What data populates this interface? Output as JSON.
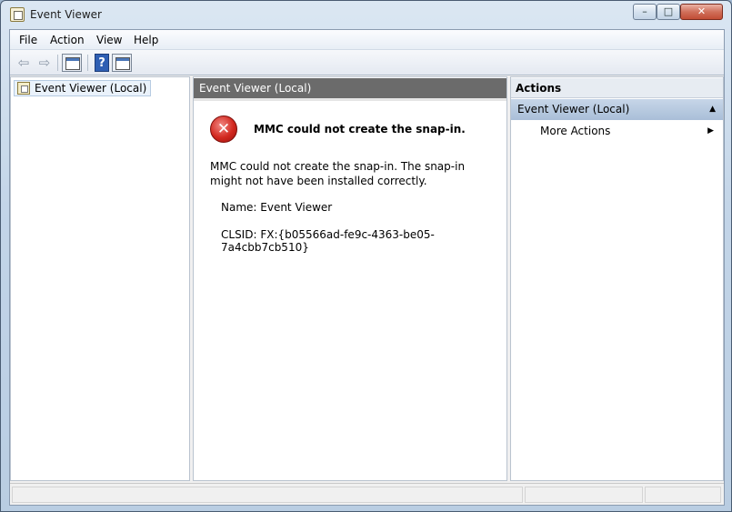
{
  "window": {
    "title": "Event Viewer",
    "minimize": "–",
    "maximize": "□",
    "close": "✕"
  },
  "menu": [
    "File",
    "Action",
    "View",
    "Help"
  ],
  "toolbar": {
    "back": "⇦",
    "forward": "⇨",
    "help": "?"
  },
  "tree": {
    "root_label": "Event Viewer (Local)"
  },
  "center": {
    "header": "Event Viewer (Local)",
    "error_title": "MMC could not create the snap-in.",
    "error_message": "MMC could not create the snap-in. The snap-in might not have been installed correctly.",
    "name_line": "Name: Event Viewer",
    "clsid_line": "CLSID: FX:{b05566ad-fe9c-4363-be05-7a4cbb7cb510}"
  },
  "actions": {
    "header": "Actions",
    "group": "Event Viewer (Local)",
    "items": [
      "More Actions"
    ]
  },
  "icons": {
    "error_icon": "✕",
    "collapse_arrow": "▲",
    "submenu_arrow": "▶"
  }
}
